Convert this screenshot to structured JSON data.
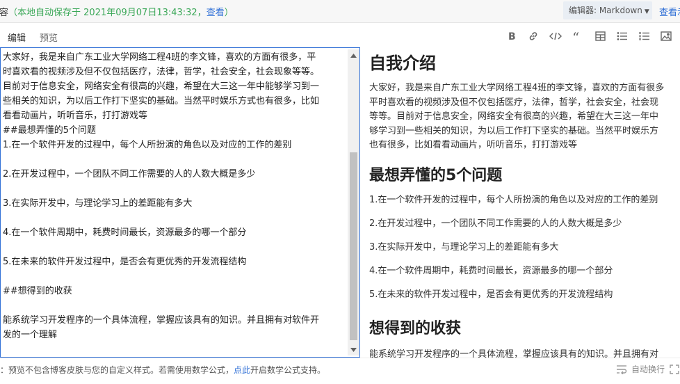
{
  "topbar": {
    "prefix_text": "内容",
    "autosave_text": "（本地自动保存于 2021年09月07日13:43:32，",
    "view_link": "查看",
    "autosave_close": "）",
    "editor_mode": "编辑器: Markdown",
    "right_link": "查看示"
  },
  "tabs": [
    {
      "label": "编辑",
      "active": true
    },
    {
      "label": "预览",
      "active": false
    }
  ],
  "toolbar_icons": [
    "bold-icon",
    "link-icon",
    "code-icon",
    "quote-icon",
    "table-icon",
    "bullet-list-icon",
    "numbered-list-icon",
    "image-icon"
  ],
  "editor": {
    "lines": [
      "大家好，我是来自广东工业大学网络工程4班的李文锋，喜欢的方面有很多，平",
      "时喜欢看的视频涉及但不仅包括医疗，法律，哲学，社会安全，社会现象等等。",
      "目前对于信息安全，网络安全有很高的兴趣，希望在大三这一年中能够学习到一",
      "些相关的知识，为以后工作打下坚实的基础。当然平时娱乐方式也有很多，比如",
      "看看动画片，听听音乐，打打游戏等",
      "##最想弄懂的5个问题",
      "1.在一个软件开发的过程中，每个人所扮演的角色以及对应的工作的差别",
      "",
      "2.在开发过程中，一个团队不同工作需要的人的人数大概是多少",
      "",
      "3.在实际开发中，与理论学习上的差距能有多大",
      "",
      "4.在一个软件周期中，耗费时间最长，资源最多的哪一个部分",
      "",
      "5.在未来的软件开发过程中，是否会有更优秀的开发流程结构",
      "",
      "##想得到的收获",
      "",
      "能系统学习开发程序的一个具体流程，掌握应该具有的知识。并且拥有对软件开",
      "发的一个理解"
    ]
  },
  "preview": {
    "h1": "自我介绍",
    "intro_lines": [
      "大家好，我是来自广东工业大学网络工程4班的李文锋，喜欢的方面有很多",
      "平时喜欢看的视频涉及但不仅包括医疗，法律，哲学，社会安全，社会现",
      "等等。目前对于信息安全，网络安全有很高的兴趣，希望在大三这一年中",
      "够学习到一些相关的知识，为以后工作打下坚实的基础。当然平时娱乐方",
      "也有很多，比如看看动画片，听听音乐，打打游戏等"
    ],
    "h2_questions": "最想弄懂的5个问题",
    "items": [
      "1.在一个软件开发的过程中，每个人所扮演的角色以及对应的工作的差别",
      "2.在开发过程中，一个团队不同工作需要的人的人数大概是多少",
      "3.在实际开发中，与理论学习上的差距能有多大",
      "4.在一个软件周期中，耗费时间最长，资源最多的哪一个部分",
      "5.在未来的软件开发过程中，是否会有更优秀的开发流程结构"
    ],
    "h2_gains": "想得到的收获",
    "gains_text": "能系统学习开发程序的一个具体流程，掌握应该具有的知识。并且拥有对"
  },
  "footer": {
    "note_text": "注：预览不包含博客皮肤与您的自定义样式。若需使用数学公式，",
    "note_link": "点此",
    "note_after": "开启数学公式支持。",
    "auto_wrap": "自动换行"
  },
  "colors": {
    "accent": "#2f6fd6",
    "autosave_green": "#3aa757"
  }
}
